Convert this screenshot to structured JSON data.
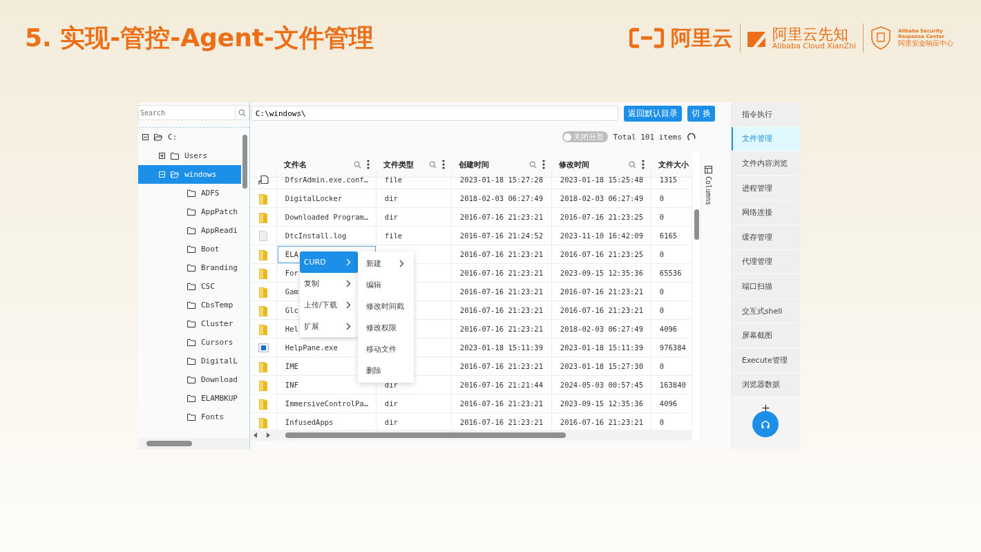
{
  "slide": {
    "title": "5. 实现-管控-Agent-文件管理",
    "logos": {
      "aliyun": "阿里云",
      "xianzhi": "阿里云先知",
      "xianzhi_en": "Alibaba Cloud XianZhi",
      "asrc_en_1": "Alibaba Security",
      "asrc_en_2": "Response Center",
      "asrc_cn": "阿里安全响应中心"
    }
  },
  "tree_panel": {
    "search": {
      "placeholder": "Search"
    },
    "tree": [
      {
        "label": "C:",
        "expanded": true,
        "selected": false,
        "children": [
          {
            "label": "Users",
            "expanded": false,
            "selected": false
          },
          {
            "label": "windows",
            "expanded": true,
            "selected": true,
            "children": [
              {
                "label": "ADFS",
                "selected": false
              },
              {
                "label": "AppPatch",
                "selected": false
              },
              {
                "label": "AppReadi",
                "selected": false
              },
              {
                "label": "Boot",
                "selected": false
              },
              {
                "label": "Branding",
                "selected": false
              },
              {
                "label": "CSC",
                "selected": false
              },
              {
                "label": "CbsTemp",
                "selected": false
              },
              {
                "label": "Cluster",
                "selected": false
              },
              {
                "label": "Cursors",
                "selected": false
              },
              {
                "label": "DigitalL",
                "selected": false
              },
              {
                "label": "Download",
                "selected": false
              },
              {
                "label": "ELAMBKUP",
                "selected": false
              },
              {
                "label": "Fonts",
                "selected": false
              }
            ]
          }
        ]
      }
    ]
  },
  "toolbar": {
    "path": "C:\\windows\\",
    "buttons": [
      "返回默认目录",
      "切 换"
    ],
    "paging_toggle": {
      "label": "关闭分页",
      "on": false
    },
    "total": "Total 101 items"
  },
  "table": {
    "columns": [
      "文件名",
      "文件类型",
      "创建时间",
      "修改时间",
      "文件大小"
    ],
    "side_tab": "Columns",
    "rows": [
      {
        "kind": "config",
        "name": "DfsrAdmin.exe.conf…",
        "type": "file",
        "created": "2023-01-18 15:27:28",
        "modified": "2023-01-18 15:25:48",
        "size": "1315",
        "selected": false
      },
      {
        "kind": "dir",
        "name": "DigitalLocker",
        "type": "dir",
        "created": "2018-02-03 06:27:49",
        "modified": "2018-02-03 06:27:49",
        "size": "0",
        "selected": false
      },
      {
        "kind": "dir",
        "name": "Downloaded Program…",
        "type": "dir",
        "created": "2016-07-16 21:23:21",
        "modified": "2016-07-16 21:23:25",
        "size": "0",
        "selected": false
      },
      {
        "kind": "file",
        "name": "DtcInstall.log",
        "type": "file",
        "created": "2016-07-16 21:24:52",
        "modified": "2023-11-10 16:42:09",
        "size": "6165",
        "selected": false
      },
      {
        "kind": "dir",
        "name": "ELA",
        "created": "2016-07-16 21:23:21",
        "modified": "2016-07-16 21:23:25",
        "size": "0",
        "selected": true
      },
      {
        "kind": "dir",
        "name": "For",
        "created": "2016-07-16 21:23:21",
        "modified": "2023-09-15 12:35:36",
        "size": "65536",
        "selected": false
      },
      {
        "kind": "dir",
        "name": "Gam",
        "created": "2016-07-16 21:23:21",
        "modified": "2016-07-16 21:23:21",
        "size": "0",
        "selected": false
      },
      {
        "kind": "dir",
        "name": "Glc",
        "created": "2016-07-16 21:23:21",
        "modified": "2016-07-16 21:23:21",
        "size": "0",
        "selected": false
      },
      {
        "kind": "dir",
        "name": "Hel",
        "created": "2016-07-16 21:23:21",
        "modified": "2018-02-03 06:27:49",
        "size": "4096",
        "selected": false
      },
      {
        "kind": "exe",
        "name": "HelpPane.exe",
        "created": "2023-01-18 15:11:39",
        "modified": "2023-01-18 15:11:39",
        "size": "976384",
        "selected": false
      },
      {
        "kind": "dir",
        "name": "IME",
        "created": "2016-07-16 21:23:21",
        "modified": "2023-01-18 15:27:30",
        "size": "0",
        "selected": false
      },
      {
        "kind": "dir",
        "name": "INF",
        "type": "dir",
        "created": "2016-07-16 21:21:44",
        "modified": "2024-05-03 00:57:45",
        "size": "163840",
        "selected": false
      },
      {
        "kind": "dir",
        "name": "ImmersiveControlPa…",
        "type": "dir",
        "created": "2016-07-16 21:23:21",
        "modified": "2023-09-15 12:35:36",
        "size": "4096",
        "selected": false
      },
      {
        "kind": "dir",
        "name": "InfusedApps",
        "type": "dir",
        "created": "2016-07-16 21:23:21",
        "modified": "2016-07-16 21:23:21",
        "size": "0",
        "selected": false
      }
    ]
  },
  "context_menu": {
    "items": [
      {
        "label": "CURD",
        "selected": true,
        "submenu": true
      },
      {
        "label": "复制",
        "selected": false,
        "submenu": true
      },
      {
        "label": "上传/下载",
        "selected": false,
        "submenu": true
      },
      {
        "label": "扩展",
        "selected": false,
        "submenu": true
      }
    ],
    "submenu_items": [
      {
        "label": "新建",
        "submenu": true
      },
      {
        "label": "编辑",
        "submenu": false
      },
      {
        "label": "修改时间戳",
        "submenu": false
      },
      {
        "label": "修改权限",
        "submenu": false
      },
      {
        "label": "移动文件",
        "submenu": false
      },
      {
        "label": "删除",
        "submenu": false
      }
    ]
  },
  "sidebar": {
    "items": [
      {
        "label": "指令执行",
        "selected": false
      },
      {
        "label": "文件管理",
        "selected": true
      },
      {
        "label": "文件内容浏览",
        "selected": false
      },
      {
        "label": "进程管理",
        "selected": false
      },
      {
        "label": "网络连接",
        "selected": false
      },
      {
        "label": "缓存管理",
        "selected": false
      },
      {
        "label": "代理管理",
        "selected": false
      },
      {
        "label": "端口扫描",
        "selected": false
      },
      {
        "label": "交互式shell",
        "selected": false
      },
      {
        "label": "屏幕截图",
        "selected": false
      },
      {
        "label": "Execute管理",
        "selected": false
      },
      {
        "label": "浏览器数据",
        "selected": false
      }
    ],
    "add_label": "+"
  }
}
